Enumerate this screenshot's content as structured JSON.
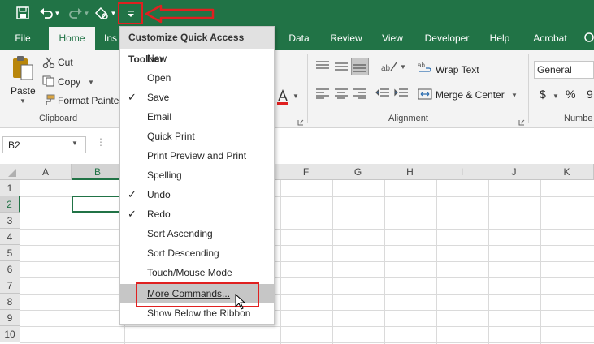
{
  "qat": {
    "save_icon": "save-icon",
    "undo_icon": "undo-icon",
    "redo_icon": "redo-icon",
    "touch_icon": "touch-mode-icon",
    "customize_icon": "customize-qat-icon"
  },
  "tabs": [
    "File",
    "Home",
    "Ins",
    "Data",
    "Review",
    "View",
    "Developer",
    "Help",
    "Acrobat"
  ],
  "ribbon": {
    "clipboard": {
      "paste": "Paste",
      "cut": "Cut",
      "copy": "Copy",
      "format_painter": "Format Painter",
      "group": "Clipboard"
    },
    "alignment": {
      "wrap_text": "Wrap Text",
      "merge_center": "Merge & Center",
      "group": "Alignment"
    },
    "number": {
      "format": "General",
      "currency": "$",
      "percent": "%",
      "comma": "9",
      "group": "Numbe"
    }
  },
  "name_box": "B2",
  "columns": [
    "A",
    "B",
    "C",
    "D",
    "E",
    "F",
    "G",
    "H",
    "I",
    "J",
    "K"
  ],
  "rows": [
    "1",
    "2",
    "3",
    "4",
    "5",
    "6",
    "7",
    "8",
    "9",
    "10"
  ],
  "menu": {
    "title": "Customize Quick Access Toolbar",
    "items": [
      {
        "label": "New",
        "checked": false
      },
      {
        "label": "Open",
        "checked": false
      },
      {
        "label": "Save",
        "checked": true
      },
      {
        "label": "Email",
        "checked": false
      },
      {
        "label": "Quick Print",
        "checked": false
      },
      {
        "label": "Print Preview and Print",
        "checked": false
      },
      {
        "label": "Spelling",
        "checked": false
      },
      {
        "label": "Undo",
        "checked": true
      },
      {
        "label": "Redo",
        "checked": true
      },
      {
        "label": "Sort Ascending",
        "checked": false
      },
      {
        "label": "Sort Descending",
        "checked": false
      },
      {
        "label": "Touch/Mouse Mode",
        "checked": false
      },
      {
        "label": "More Commands...",
        "checked": false
      },
      {
        "label": "Show Below the Ribbon",
        "checked": false
      }
    ]
  },
  "colors": {
    "excel_green": "#217346",
    "highlight_red": "#e02020"
  }
}
